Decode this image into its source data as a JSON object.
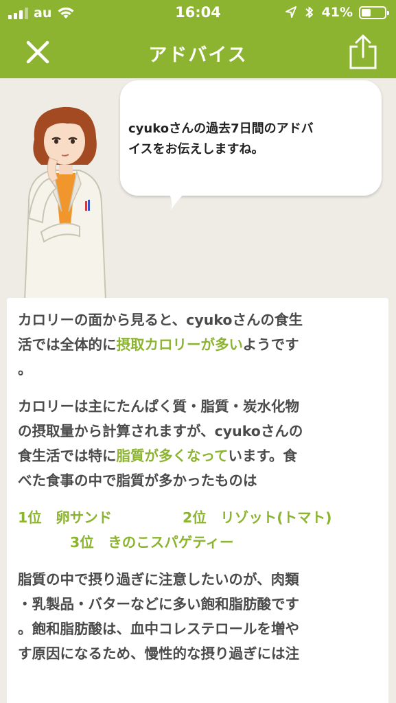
{
  "status_bar": {
    "carrier": "au",
    "time": "16:04",
    "battery_percent": "41%",
    "battery_level": 0.41
  },
  "nav": {
    "title": "アドバイス",
    "close_icon": "close-icon",
    "share_icon": "share-icon"
  },
  "bubble": {
    "line1": "cyukoさんの過去7日間のアドバ",
    "line2": "イスをお伝えしますね。"
  },
  "advice": {
    "p1_a": "カロリーの面から見ると、cyukoさんの食生",
    "p1_b": "活では全体的に",
    "p1_hl": "摂取カロリーが多い",
    "p1_c": "ようです",
    "p1_d": "。",
    "p2_a": "カロリーは主にたんぱく質・脂質・炭水化物",
    "p2_b": "の摂取量から計算されますが、cyukoさんの",
    "p2_c": "食生活では特に",
    "p2_hl": "脂質が多くなって",
    "p2_d": "います。食",
    "p2_e": "べた食事の中で脂質が多かったものは",
    "rank1": "1位　卵サンド",
    "rank2": "2位　リゾット(トマト)",
    "rank3": "3位　きのこスパゲティー",
    "p3_a": "脂質の中で摂り過ぎに注意したいのが、肉類",
    "p3_b": "・乳製品・バターなどに多い飽和脂肪酸です",
    "p3_c": "。飽和脂肪酸は、血中コレステロールを増や",
    "p3_d": "す原因になるため、慢性的な摂り過ぎには注"
  },
  "colors": {
    "brand_green": "#8cb431",
    "background": "#efece6",
    "text": "#4a4a4a"
  }
}
